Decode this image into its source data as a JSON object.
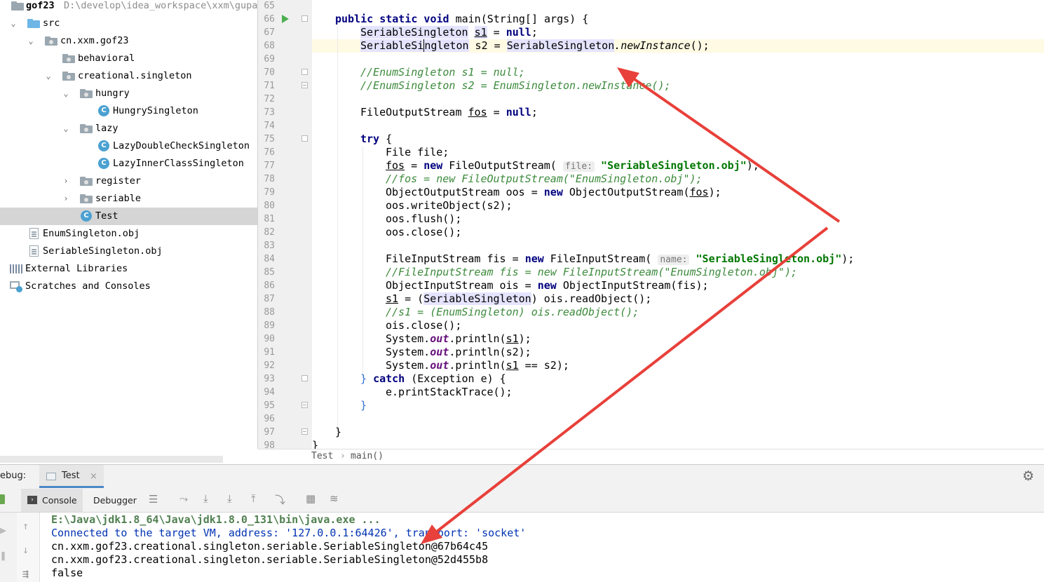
{
  "project": {
    "root_name": "gof23",
    "root_path": "D:\\develop\\idea_workspace\\xxm\\gupao",
    "items": [
      {
        "label": "src"
      },
      {
        "label": "cn.xxm.gof23"
      },
      {
        "label": "behavioral"
      },
      {
        "label": "creational.singleton"
      },
      {
        "label": "hungry"
      },
      {
        "label": "HungrySingleton"
      },
      {
        "label": "lazy"
      },
      {
        "label": "LazyDoubleCheckSingleton"
      },
      {
        "label": "LazyInnerClassSingleton"
      },
      {
        "label": "register"
      },
      {
        "label": "seriable"
      },
      {
        "label": "Test"
      },
      {
        "label": "EnumSingleton.obj"
      },
      {
        "label": "SeriableSingleton.obj"
      },
      {
        "label": "External Libraries"
      },
      {
        "label": "Scratches and Consoles"
      }
    ],
    "class_icon_letter": "C"
  },
  "editor": {
    "line_numbers": [
      "65",
      "66",
      "67",
      "68",
      "69",
      "70",
      "71",
      "72",
      "73",
      "74",
      "75",
      "76",
      "77",
      "78",
      "79",
      "80",
      "81",
      "82",
      "83",
      "84",
      "85",
      "86",
      "87",
      "88",
      "89",
      "90",
      "91",
      "92",
      "93",
      "94",
      "95",
      "96",
      "97",
      "98"
    ],
    "code": {
      "l66_kw": "public static void",
      "l66_rest": " main(String[] args) {",
      "l67_type": "SeriableSingleton",
      "l67_var": "s1",
      "l67_eq": " = ",
      "l67_null": "null",
      "l67_end": ";",
      "l68_type_a": "SeriableSi",
      "l68_type_b": "ngleton",
      "l68_var": " s2 = ",
      "l68_cls": "SeriableSingleton",
      "l68_method": ".newInstance",
      "l68_end": "();",
      "l70": "//EnumSingleton s1 = null;",
      "l71": "//EnumSingleton s2 = EnumSingleton.newInstance();",
      "l73_a": "FileOutputStream ",
      "l73_var": "fos",
      "l73_eq": " = ",
      "l73_null": "null",
      "l73_end": ";",
      "l75_kw": "try",
      "l75_rest": " {",
      "l76": "File file;",
      "l77_var": "fos",
      "l77_eq": " = ",
      "l77_new": "new",
      "l77_cls": " FileOutputStream(",
      "l77_hint": "file:",
      "l77_str": "\"SeriableSingleton.obj\"",
      "l77_end": ");",
      "l78": "//fos = new FileOutputStream(\"EnumSingleton.obj\");",
      "l79_a": "ObjectOutputStream oos = ",
      "l79_new": "new",
      "l79_b": " ObjectOutputStream(",
      "l79_var": "fos",
      "l79_end": ");",
      "l80": "oos.writeObject(s2);",
      "l81": "oos.flush();",
      "l82": "oos.close();",
      "l84_a": "FileInputStream fis = ",
      "l84_new": "new",
      "l84_b": " FileInputStream(",
      "l84_hint": "name:",
      "l84_str": "\"SeriableSingleton.obj\"",
      "l84_end": ");",
      "l85": "//FileInputStream fis = new FileInputStream(\"EnumSingleton.obj\");",
      "l86_a": "ObjectInputStream ois = ",
      "l86_new": "new",
      "l86_b": " ObjectInputStream(fis);",
      "l87_var": "s1",
      "l87_a": " = (",
      "l87_cls": "SeriableSingleton",
      "l87_b": ") ois.readObject();",
      "l88": "//s1 = (EnumSingleton) ois.readObject();",
      "l89": "ois.close();",
      "sys": "System.",
      "out": "out",
      "l90_b": ".println(",
      "l90_var": "s1",
      "l90_end": ");",
      "l91_b": ".println(s2);",
      "l92_b": ".println(",
      "l92_var": "s1",
      "l92_end": " == s2);",
      "l93_a": "} ",
      "l93_kw": "catch",
      "l93_b": " (Exception e) {",
      "l94": "e.printStackTrace();",
      "l95": "}",
      "l97": "}",
      "l98": "}"
    },
    "breadcrumb": [
      "Test",
      "main()"
    ],
    "breadcrumb_sep": "›"
  },
  "debug": {
    "label": "ebug:",
    "tab": "Test",
    "tab_close": "×",
    "subtabs": [
      "Console",
      "Debugger"
    ]
  },
  "console": {
    "lines": [
      "E:\\Java\\jdk1.8_64\\Java\\jdk1.8.0_131\\bin\\java.exe ...",
      "Connected to the target VM, address: '127.0.0.1:64426', transport: 'socket'",
      "cn.xxm.gof23.creational.singleton.seriable.SeriableSingleton@67b64c45",
      "cn.xxm.gof23.creational.singleton.seriable.SeriableSingleton@52d455b8",
      "false"
    ]
  },
  "colors": {
    "keyword": "#000080",
    "comment": "#3c8a3c",
    "string": "#007700",
    "arrow": "#e8403a",
    "console_connected": "#0033b3",
    "console_cmd": "#508050"
  }
}
